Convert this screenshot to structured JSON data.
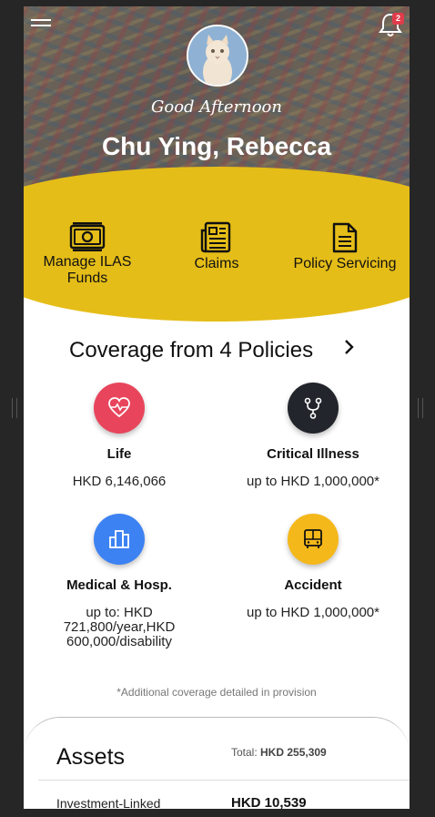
{
  "header": {
    "notification_count": "2",
    "greeting": "Good Afternoon",
    "user_name": "Chu Ying, Rebecca"
  },
  "quick_actions": [
    {
      "label": "Manage ILAS Funds",
      "icon": "money-bill-icon"
    },
    {
      "label": "Claims",
      "icon": "newspaper-icon"
    },
    {
      "label": "Policy Servicing",
      "icon": "document-icon"
    }
  ],
  "coverage": {
    "title": "Coverage from 4 Policies",
    "items": [
      {
        "name": "Life",
        "amount": "HKD 6,146,066",
        "color": "#e8455c",
        "icon": "heartbeat-icon"
      },
      {
        "name": "Critical Illness",
        "amount": "up to HKD 1,000,000*",
        "color": "#22252b",
        "icon": "stethoscope-icon"
      },
      {
        "name": "Medical & Hosp.",
        "amount": "up to: HKD 721,800/year,HKD 600,000/disability",
        "color": "#3d82f2",
        "icon": "building-icon"
      },
      {
        "name": "Accident",
        "amount": "up to HKD 1,000,000*",
        "color": "#f5b81a",
        "icon": "bus-icon"
      }
    ],
    "footnote": "*Additional coverage detailed in provision"
  },
  "assets": {
    "title": "Assets",
    "total_label": "Total:",
    "total_value": "HKD 255,309",
    "rows": [
      {
        "label": "Investment-Linked",
        "value": "HKD 10,539"
      }
    ]
  },
  "colors": {
    "accent_yellow": "#e5bd18",
    "badge_red": "#e23b4a"
  }
}
